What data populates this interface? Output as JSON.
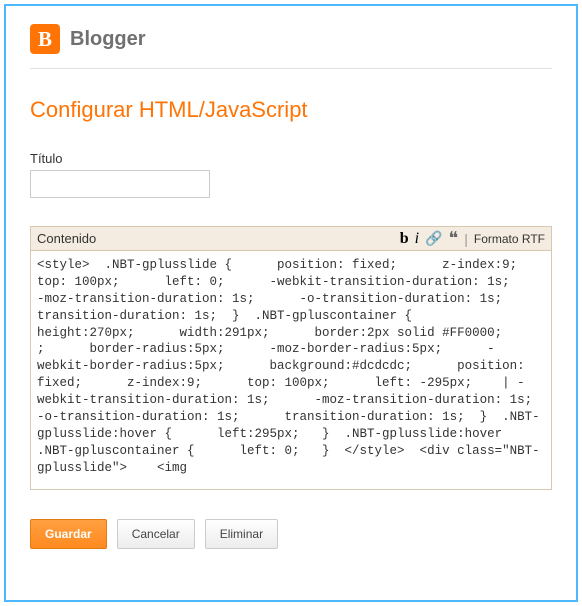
{
  "header": {
    "logo_letter": "B",
    "product_name": "Blogger"
  },
  "page_title": "Configurar HTML/JavaScript",
  "title_field": {
    "label": "Título",
    "value": ""
  },
  "content_field": {
    "label": "Contenido",
    "toolbar": {
      "bold": "b",
      "italic": "i",
      "link": "🔗",
      "quote": "❝",
      "rtf": "Formato RTF"
    },
    "value": "<style>  .NBT-gplusslide {      position: fixed;      z-index:9;      top: 100px;      left: 0;      -webkit-transition-duration: 1s;      -moz-transition-duration: 1s;      -o-transition-duration: 1s;      transition-duration: 1s;  }  .NBT-gpluscontainer {      height:270px;      width:291px;      border:2px solid #FF0000;      ;      border-radius:5px;      -moz-border-radius:5px;      -webkit-border-radius:5px;      background:#dcdcdc;      position: fixed;      z-index:9;      top: 100px;      left: -295px;    | -webkit-transition-duration: 1s;      -moz-transition-duration: 1s;      -o-transition-duration: 1s;      transition-duration: 1s;  }  .NBT-gplusslide:hover {      left:295px;   }  .NBT-gplusslide:hover .NBT-gpluscontainer {      left: 0;   }  </style>  <div class=\"NBT-gplusslide\">    <img"
  },
  "buttons": {
    "save": "Guardar",
    "cancel": "Cancelar",
    "delete": "Eliminar"
  }
}
